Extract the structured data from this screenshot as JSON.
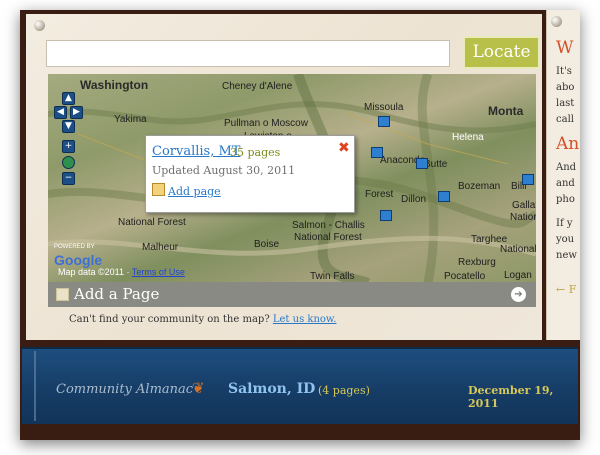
{
  "search": {
    "value": "",
    "button_label": "Locate"
  },
  "map": {
    "labels": {
      "washington": "Washington",
      "cheney": "Cheney d'Alene",
      "yakima": "Yakima",
      "pullman": "Pullman o Moscow",
      "lewiston": "Lewiston o",
      "missoula": "Missoula",
      "helena": "Helena",
      "monta": "Monta",
      "anaconda": "Anaconda",
      "butte": "Butte",
      "bozeman": "Bozeman",
      "billi": "Billi",
      "forest": "Forest",
      "dillon": "Dillon",
      "gallatin": "Gallatin",
      "national_forest": "National Forest",
      "national_forest_2": "National Forest",
      "national_forest_3": "National Forest",
      "salmon_challis": "Salmon - Challis",
      "malheur": "Malheur",
      "boise": "Boise",
      "targhee": "Targhee",
      "rexburg": "Rexburg",
      "twin_falls": "Twin Falls",
      "pocatello": "Pocatello",
      "logan": "Logan",
      "national_forest_4": "National Forest"
    },
    "controls": {
      "up": "▲",
      "left": "◀",
      "right": "▶",
      "down": "▼",
      "zoom_in": "+",
      "zoom_out": "−"
    },
    "powered_by": "POWERED BY",
    "google": "Google",
    "copyright_prefix": "Map data ©2011",
    "terms": "Terms of Use"
  },
  "popup": {
    "title": "Corvallis, MT",
    "pages": "35 pages",
    "updated": "Updated August 30, 2011",
    "add_page": "Add page",
    "close": "✖"
  },
  "add_bar": {
    "label": "Add a Page",
    "arrow": "➔"
  },
  "cant_find": {
    "text": "Can't find your community on the map?",
    "link": "Let us know."
  },
  "side": {
    "head1": "W",
    "line1": "It's",
    "line2": "abo",
    "line3": "last",
    "line4": "call",
    "head2": "An",
    "line5": "And",
    "line6": "and",
    "line7": "pho",
    "line8": "If y",
    "line9": "you",
    "line10": "new",
    "arrow": "← F"
  },
  "bottom": {
    "brand": "Community Almanac",
    "place": "Salmon, ID",
    "pages": "(4 pages)",
    "date": "December 19, 2011"
  }
}
